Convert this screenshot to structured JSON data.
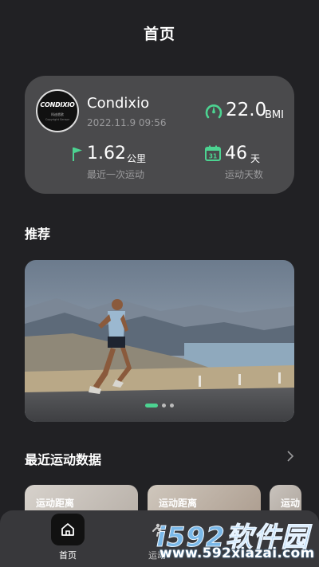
{
  "header": {
    "title": "首页"
  },
  "profile": {
    "logo": {
      "main": "CONDIXIO",
      "sub": "科迪悉欧",
      "sub2": "Copyright Sensor"
    },
    "name": "Condixio",
    "date": "2022.11.9 09:56",
    "bmi": {
      "value": "22.0",
      "unit": "BMI",
      "icon": "bmi-gauge-icon",
      "color": "#4cd391"
    },
    "distance": {
      "value": "1.62",
      "unit": "公里",
      "label": "最近一次运动",
      "icon": "flag-icon"
    },
    "days": {
      "value": "46",
      "unit": "天",
      "label": "运动天数",
      "icon": "calendar-icon",
      "calendar_day": "31"
    }
  },
  "recommend": {
    "title": "推荐",
    "banner": {
      "slides": 3,
      "active_index": 0
    }
  },
  "recent": {
    "title": "最近运动数据",
    "cards": [
      {
        "label": "运动距离"
      },
      {
        "label": "运动距离"
      },
      {
        "label": "运动"
      }
    ]
  },
  "nav": {
    "items": [
      {
        "label": "首页",
        "icon": "home-icon",
        "active": true
      },
      {
        "label": "运动",
        "icon": "sport-icon",
        "active": false
      }
    ]
  },
  "watermark": {
    "logo": "i592软件园",
    "url": "www.592xiazai.com"
  },
  "colors": {
    "accent": "#4cd391",
    "background": "#212124",
    "card": "#4a4a4c",
    "nav": "#38383b"
  }
}
